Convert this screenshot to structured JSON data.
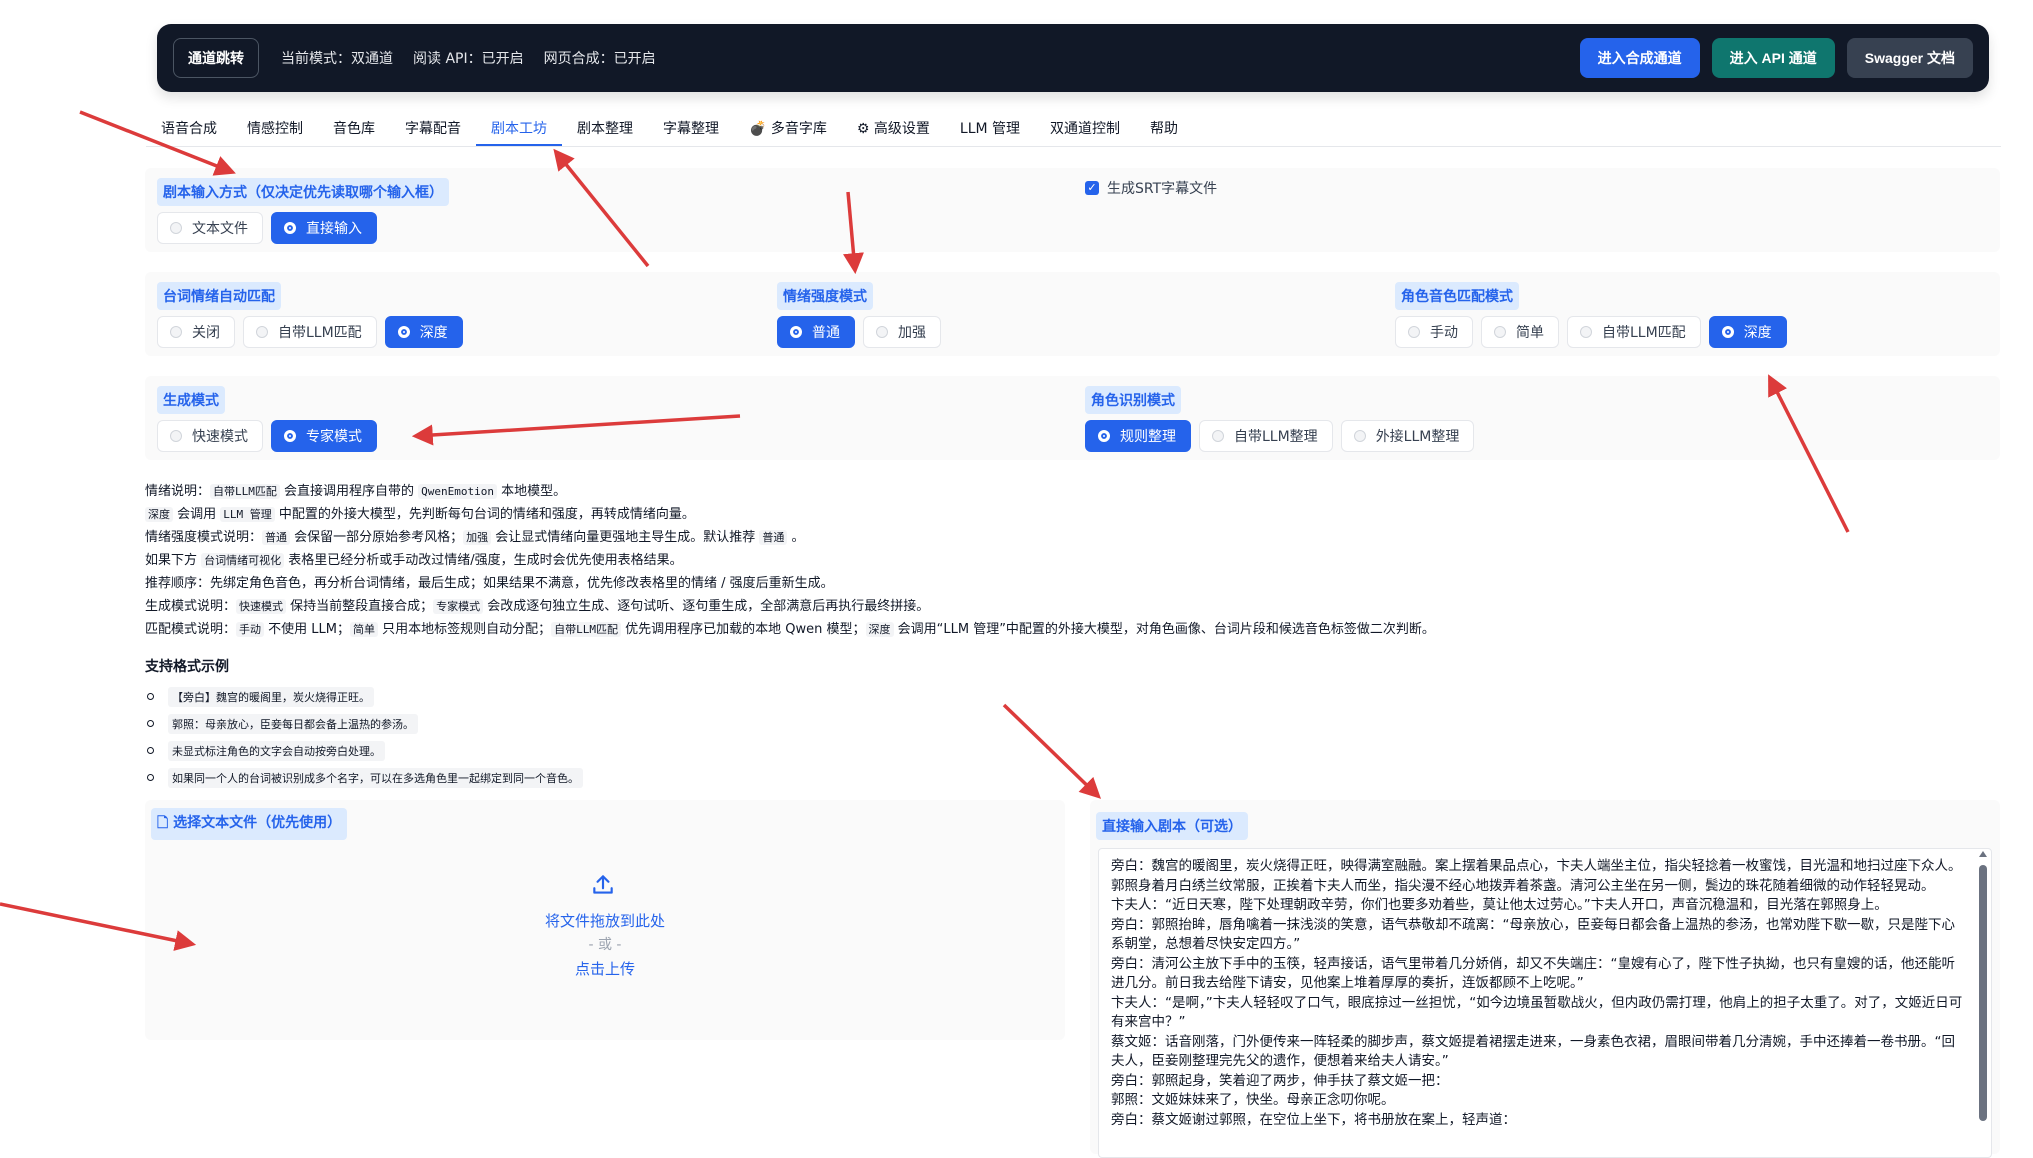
{
  "topbar": {
    "jump_label": "通道跳转",
    "mode": "当前模式：双通道",
    "read_api": "阅读 API：已开启",
    "web_synth": "网页合成：已开启",
    "btn_synth": "进入合成通道",
    "btn_api": "进入 API 通道",
    "btn_swagger": "Swagger 文档"
  },
  "tabs": [
    "语音合成",
    "情感控制",
    "音色库",
    "字幕配音",
    "剧本工坊",
    "剧本整理",
    "字幕整理",
    "💣 多音字库",
    "⚙ 高级设置",
    "LLM 管理",
    "双通道控制",
    "帮助"
  ],
  "active_tab": "剧本工坊",
  "input_method": {
    "title": "剧本输入方式（仅决定优先读取哪个输入框）",
    "options": [
      "文本文件",
      "直接输入"
    ],
    "selected": "直接输入"
  },
  "srt": {
    "label": "生成SRT字幕文件",
    "checked": true
  },
  "emotion_match": {
    "title": "台词情绪自动匹配",
    "options": [
      "关闭",
      "自带LLM匹配",
      "深度"
    ],
    "selected": "深度"
  },
  "emotion_strength": {
    "title": "情绪强度模式",
    "options": [
      "普通",
      "加强"
    ],
    "selected": "普通"
  },
  "voice_match": {
    "title": "角色音色匹配模式",
    "options": [
      "手动",
      "简单",
      "自带LLM匹配",
      "深度"
    ],
    "selected": "深度"
  },
  "gen_mode": {
    "title": "生成模式",
    "options": [
      "快速模式",
      "专家模式"
    ],
    "selected": "专家模式"
  },
  "role_mode": {
    "title": "角色识别模式",
    "options": [
      "规则整理",
      "自带LLM整理",
      "外接LLM整理"
    ],
    "selected": "规则整理"
  },
  "notes": {
    "l1a": "情绪说明：",
    "l1b": "自带LLM匹配",
    "l1c": " 会直接调用程序自带的 ",
    "l1d": "QwenEmotion",
    "l1e": " 本地模型。",
    "l2a": "深度",
    "l2b": " 会调用 ",
    "l2c": "LLM 管理",
    "l2d": " 中配置的外接大模型，先判断每句台词的情绪和强度，再转成情绪向量。",
    "l3a": "情绪强度模式说明：",
    "l3b": "普通",
    "l3c": " 会保留一部分原始参考风格；",
    "l3d": "加强",
    "l3e": " 会让显式情绪向量更强地主导生成。默认推荐 ",
    "l3f": "普通",
    "l3g": " 。",
    "l4a": "如果下方 ",
    "l4b": "台词情绪可视化",
    "l4c": " 表格里已经分析或手动改过情绪/强度，生成时会优先使用表格结果。",
    "l5": "推荐顺序：先绑定角色音色，再分析台词情绪，最后生成；如果结果不满意，优先修改表格里的情绪 / 强度后重新生成。",
    "l6a": "生成模式说明：",
    "l6b": "快速模式",
    "l6c": " 保持当前整段直接合成；",
    "l6d": "专家模式",
    "l6e": " 会改成逐句独立生成、逐句试听、逐句重生成，全部满意后再执行最终拼接。",
    "l7a": "匹配模式说明：",
    "l7b": "手动",
    "l7c": " 不使用 LLM；",
    "l7d": "简单",
    "l7e": " 只用本地标签规则自动分配；",
    "l7f": "自带LLM匹配",
    "l7g": " 优先调用程序已加载的本地 Qwen 模型；",
    "l7h": "深度",
    "l7i": " 会调用“LLM 管理”中配置的外接大模型，对角色画像、台词片段和候选音色标签做二次判断。"
  },
  "formats": {
    "title": "支持格式示例",
    "items": [
      "【旁白】魏宫的暖阁里，炭火烧得正旺。",
      "郭照：母亲放心，臣妾每日都会备上温热的参汤。",
      "未显式标注角色的文字会自动按旁白处理。",
      "如果同一个人的台词被识别成多个名字，可以在多选角色里一起绑定到同一个音色。"
    ]
  },
  "upload": {
    "title": "选择文本文件（优先使用）",
    "drop": "将文件拖放到此处",
    "or": "- 或 -",
    "click": "点击上传"
  },
  "script": {
    "title": "直接输入剧本（可选）",
    "lines": [
      "旁白：魏宫的暖阁里，炭火烧得正旺，映得满室融融。案上摆着果品点心，卞夫人端坐主位，指尖轻捻着一枚蜜饯，目光温和地扫过座下众人。郭照身着月白绣兰纹常服，正挨着卞夫人而坐，指尖漫不经心地拨弄着茶盏。清河公主坐在另一侧，鬓边的珠花随着细微的动作轻轻晃动。",
      "卞夫人：“近日天寒，陛下处理朝政辛劳，你们也要多劝着些，莫让他太过劳心。”卞夫人开口，声音沉稳温和，目光落在郭照身上。",
      "旁白：郭照抬眸，唇角噙着一抹浅淡的笑意，语气恭敬却不疏离：“母亲放心，臣妾每日都会备上温热的参汤，也常劝陛下歇一歇，只是陛下心系朝堂，总想着尽快安定四方。”",
      "旁白：清河公主放下手中的玉筷，轻声接话，语气里带着几分娇俏，却又不失端庄：“皇嫂有心了，陛下性子执拗，也只有皇嫂的话，他还能听进几分。前日我去给陛下请安，见他案上堆着厚厚的奏折，连饭都顾不上吃呢。”",
      "卞夫人：“是啊，”卞夫人轻轻叹了口气，眼底掠过一丝担忧，“如今边境虽暂歇战火，但内政仍需打理，他肩上的担子太重了。对了，文姬近日可有来宫中？”",
      "蔡文姬：话音刚落，门外便传来一阵轻柔的脚步声，蔡文姬提着裙摆走进来，一身素色衣裙，眉眼间带着几分清婉，手中还捧着一卷书册。“回夫人，臣妾刚整理完先父的遗作，便想着来给夫人请安。”",
      "旁白：郭照起身，笑着迎了两步，伸手扶了蔡文姬一把：",
      "郭照：文姬妹妹来了，快坐。母亲正念叨你呢。",
      "旁白：蔡文姬谢过郭照，在空位上坐下，将书册放在案上，轻声道："
    ]
  }
}
